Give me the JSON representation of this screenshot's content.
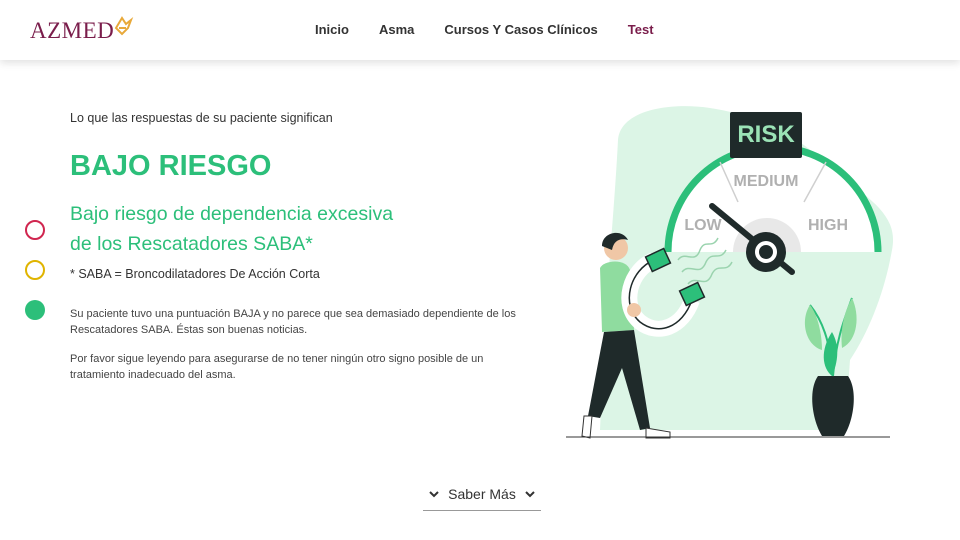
{
  "header": {
    "logo_text": "AZMED",
    "nav": [
      {
        "label": "Inicio",
        "active": false
      },
      {
        "label": "Asma",
        "active": false
      },
      {
        "label": "Cursos Y Casos Clínicos",
        "active": false
      },
      {
        "label": "Test",
        "active": true
      }
    ]
  },
  "main": {
    "intro": "Lo que las respuestas de su paciente significan",
    "title": "BAJO RIESGO",
    "subtitle_line1": "Bajo riesgo de dependencia excesiva",
    "subtitle_line2": "de los Rescatadores SABA*",
    "footnote": "* SABA = Broncodilatadores De Acción Corta",
    "paragraph1": "Su paciente tuvo una puntuación BAJA y no parece que sea demasiado dependiente de los Rescatadores SABA. Éstas son buenas noticias.",
    "paragraph2": "Por favor sigue leyendo para asegurarse de no tener ningún otro signo posible de un tratamiento inadecuado del asma."
  },
  "risk_indicator": {
    "levels": [
      {
        "name": "high",
        "color": "#d0264f",
        "filled": false
      },
      {
        "name": "medium",
        "color": "#e0b400",
        "filled": false
      },
      {
        "name": "low",
        "color": "#2cbf7a",
        "filled": true
      }
    ]
  },
  "illustration": {
    "gauge_title": "RISK",
    "gauge_labels": {
      "low": "LOW",
      "medium": "MEDIUM",
      "high": "HIGH"
    }
  },
  "more_button": {
    "label": "Saber Más"
  },
  "colors": {
    "brand": "#7a1d4b",
    "accent_green": "#2cbf7a",
    "light_green": "#dcf5e6",
    "gold": "#e8a93a"
  }
}
